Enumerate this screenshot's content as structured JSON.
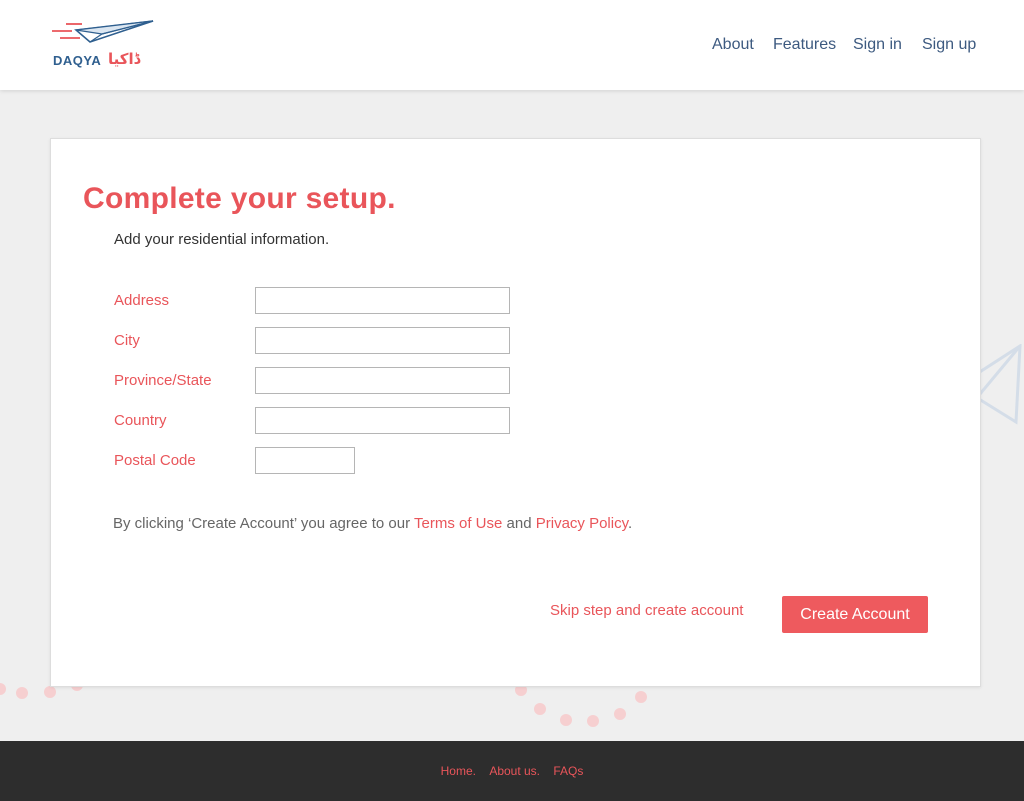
{
  "brand": {
    "name": "DAQYA",
    "name_urdu": "ڈاکیا",
    "accent_color": "#e9555a",
    "navy_color": "#3d5a80"
  },
  "nav": {
    "about": "About",
    "features": "Features",
    "sign_in": "Sign in",
    "sign_up": "Sign up"
  },
  "form": {
    "title": "Complete your setup.",
    "subtitle": "Add your residential information.",
    "fields": [
      {
        "label": "Address",
        "value": ""
      },
      {
        "label": "City",
        "value": ""
      },
      {
        "label": "Province/State",
        "value": ""
      },
      {
        "label": "Country",
        "value": ""
      },
      {
        "label": "Postal Code",
        "value": ""
      }
    ],
    "terms_prefix": "By clicking ‘Create Account’ you agree to our ",
    "terms_link": "Terms of Use",
    "terms_and": " and ",
    "privacy_link": "Privacy Policy",
    "terms_suffix": ".",
    "skip_label": "Skip step and create account",
    "create_label": "Create Account"
  },
  "footer": {
    "home": "Home.",
    "about": "About us.",
    "faqs": "FAQs"
  },
  "icons": [
    "paper-plane-logo-icon",
    "paper-plane-decoration-icon"
  ]
}
